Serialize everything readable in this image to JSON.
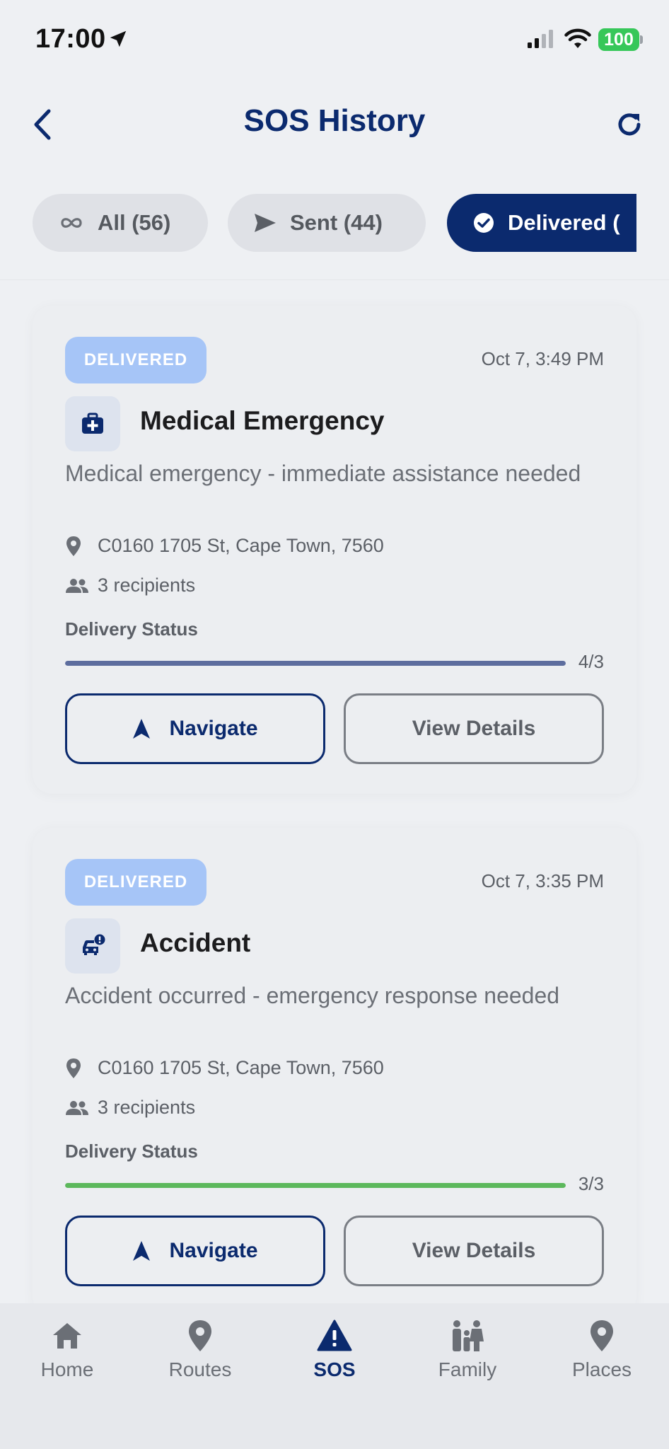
{
  "status_bar": {
    "time": "17:00",
    "battery": "100"
  },
  "header": {
    "title": "SOS History"
  },
  "filters": [
    {
      "label": "All (56)",
      "icon": "infinity-icon"
    },
    {
      "label": "Sent (44)",
      "icon": "send-icon"
    },
    {
      "label": "Delivered (",
      "icon": "check-circle-icon",
      "selected": true
    }
  ],
  "cards": [
    {
      "status": "DELIVERED",
      "timestamp": "Oct 7, 3:49 PM",
      "type": "Medical Emergency",
      "icon": "medical-kit-icon",
      "description": "Medical emergency - immediate assistance needed",
      "address": "C0160 1705 St, Cape Town, 7560",
      "recipients": "3 recipients",
      "delivery_label": "Delivery Status",
      "delivery_count": "4/3",
      "progress": 1.0,
      "progress_color": "#5d6d9e",
      "navigate_label": "Navigate",
      "details_label": "View Details"
    },
    {
      "status": "DELIVERED",
      "timestamp": "Oct 7, 3:35 PM",
      "type": "Accident",
      "icon": "car-accident-icon",
      "description": "Accident occurred - emergency response needed",
      "address": "C0160 1705 St, Cape Town, 7560",
      "recipients": "3 recipients",
      "delivery_label": "Delivery Status",
      "delivery_count": "3/3",
      "progress": 1.0,
      "progress_color": "#5cb85c",
      "navigate_label": "Navigate",
      "details_label": "View Details"
    }
  ],
  "bottom_nav": [
    {
      "label": "Home",
      "icon": "home-icon"
    },
    {
      "label": "Routes",
      "icon": "location-pin-icon"
    },
    {
      "label": "SOS",
      "icon": "warning-triangle-icon",
      "active": true
    },
    {
      "label": "Family",
      "icon": "family-icon"
    },
    {
      "label": "Places",
      "icon": "location-pin-icon"
    }
  ],
  "colors": {
    "primary": "#0b2a6e",
    "badge": "#a6c5f7",
    "success": "#5cb85c",
    "background": "#eef0f3"
  }
}
